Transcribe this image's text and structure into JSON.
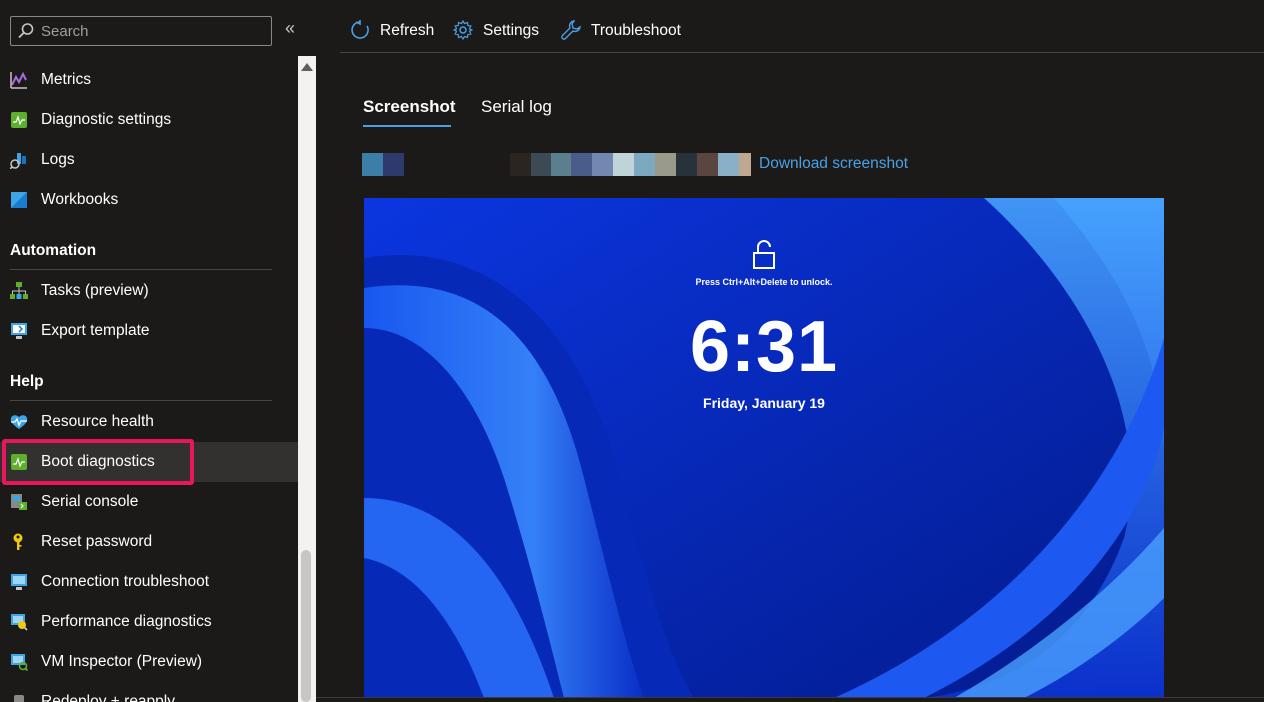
{
  "search": {
    "placeholder": "Search"
  },
  "sidebar": {
    "collapse_glyph": "«",
    "items_top": [
      {
        "label": "Metrics",
        "icon": "metrics-icon"
      },
      {
        "label": "Diagnostic settings",
        "icon": "diagnostic-settings-icon"
      },
      {
        "label": "Logs",
        "icon": "logs-icon"
      },
      {
        "label": "Workbooks",
        "icon": "workbooks-icon"
      }
    ],
    "sections": [
      {
        "title": "Automation",
        "items": [
          {
            "label": "Tasks (preview)",
            "icon": "tasks-icon"
          },
          {
            "label": "Export template",
            "icon": "export-template-icon"
          }
        ]
      },
      {
        "title": "Help",
        "items": [
          {
            "label": "Resource health",
            "icon": "resource-health-icon"
          },
          {
            "label": "Boot diagnostics",
            "icon": "boot-diagnostics-icon",
            "selected": true
          },
          {
            "label": "Serial console",
            "icon": "serial-console-icon"
          },
          {
            "label": "Reset password",
            "icon": "key-icon"
          },
          {
            "label": "Connection troubleshoot",
            "icon": "connection-troubleshoot-icon"
          },
          {
            "label": "Performance diagnostics",
            "icon": "performance-diagnostics-icon"
          },
          {
            "label": "VM Inspector (Preview)",
            "icon": "vm-inspector-icon"
          },
          {
            "label": "Redeploy + reapply",
            "icon": "redeploy-icon"
          }
        ]
      }
    ]
  },
  "toolbar": {
    "refresh_label": "Refresh",
    "settings_label": "Settings",
    "troubleshoot_label": "Troubleshoot"
  },
  "tabs": [
    {
      "label": "Screenshot",
      "active": true
    },
    {
      "label": "Serial log",
      "active": false
    }
  ],
  "download_link": "Download screenshot",
  "lock_screen": {
    "unlock_hint": "Press Ctrl+Alt+Delete to unlock.",
    "time": "6:31",
    "date": "Friday, January 19"
  },
  "colors": {
    "accent": "#4aa0e6",
    "highlight": "#e8175d",
    "background": "#1b1a19"
  }
}
